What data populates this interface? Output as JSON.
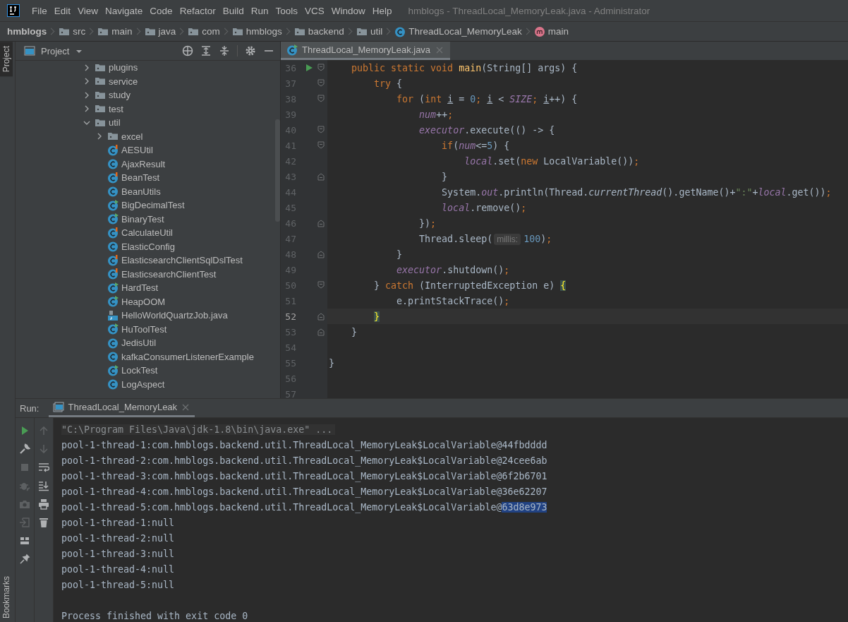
{
  "window": {
    "title": "hmblogs - ThreadLocal_MemoryLeak.java - Administrator"
  },
  "menu": [
    "File",
    "Edit",
    "View",
    "Navigate",
    "Code",
    "Refactor",
    "Build",
    "Run",
    "Tools",
    "VCS",
    "Window",
    "Help"
  ],
  "breadcrumbs": [
    {
      "kind": "project",
      "label": "hmblogs"
    },
    {
      "kind": "folder",
      "label": "src"
    },
    {
      "kind": "folder",
      "label": "main"
    },
    {
      "kind": "folder",
      "label": "java"
    },
    {
      "kind": "folder",
      "label": "com"
    },
    {
      "kind": "folder",
      "label": "hmblogs"
    },
    {
      "kind": "folder",
      "label": "backend"
    },
    {
      "kind": "folder",
      "label": "util"
    },
    {
      "kind": "class",
      "label": "ThreadLocal_MemoryLeak"
    },
    {
      "kind": "method",
      "label": "main"
    }
  ],
  "tool_windows": {
    "top": [
      {
        "label": "Project",
        "selected": true
      }
    ],
    "bottom": [
      {
        "label": "Bookmarks",
        "selected": false
      }
    ]
  },
  "project_panel": {
    "title": "Project",
    "tree": [
      {
        "kind": "folder",
        "label": "plugins",
        "expanded": false
      },
      {
        "kind": "folder",
        "label": "service",
        "expanded": false
      },
      {
        "kind": "folder",
        "label": "study",
        "expanded": false
      },
      {
        "kind": "folder",
        "label": "test",
        "expanded": false
      },
      {
        "kind": "folder",
        "label": "util",
        "expanded": true,
        "children": [
          {
            "kind": "folder",
            "label": "excel",
            "expanded": false
          },
          {
            "kind": "test_class",
            "label": "AESUtil"
          },
          {
            "kind": "class",
            "label": "AjaxResult"
          },
          {
            "kind": "test_class",
            "label": "BeanTest"
          },
          {
            "kind": "class",
            "label": "BeanUtils"
          },
          {
            "kind": "runnable_class",
            "label": "BigDecimalTest"
          },
          {
            "kind": "runnable_class",
            "label": "BinaryTest"
          },
          {
            "kind": "test_class",
            "label": "CalculateUtil"
          },
          {
            "kind": "class",
            "label": "ElasticConfig"
          },
          {
            "kind": "test_class",
            "label": "ElasticsearchClientSqlDslTest"
          },
          {
            "kind": "test_class",
            "label": "ElasticsearchClientTest"
          },
          {
            "kind": "runnable_class",
            "label": "HardTest"
          },
          {
            "kind": "runnable_class",
            "label": "HeapOOM"
          },
          {
            "kind": "java_file",
            "label": "HelloWorldQuartzJob.java"
          },
          {
            "kind": "runnable_class",
            "label": "HuToolTest"
          },
          {
            "kind": "class",
            "label": "JedisUtil"
          },
          {
            "kind": "class",
            "label": "kafkaConsumerListenerExample"
          },
          {
            "kind": "runnable_class",
            "label": "LockTest"
          },
          {
            "kind": "class",
            "label": "LogAspect"
          }
        ]
      }
    ]
  },
  "editor": {
    "tabs": [
      {
        "label": "ThreadLocal_MemoryLeak.java",
        "selected": true
      }
    ],
    "lines": [
      {
        "number": "36",
        "run": true,
        "fold_start": true,
        "current": false,
        "tokens": [
          {
            "kind": "keyword",
            "text": "    public static void "
          },
          {
            "kind": "method_decl",
            "text": "main"
          },
          {
            "kind": "plain",
            "text": "(String[] args) {"
          }
        ]
      },
      {
        "number": "37",
        "run": false,
        "fold_start": true,
        "current": false,
        "tokens": [
          {
            "kind": "keyword",
            "text": "        try "
          },
          {
            "kind": "plain",
            "text": "{"
          }
        ]
      },
      {
        "number": "38",
        "run": false,
        "fold_start": true,
        "current": false,
        "tokens": [
          {
            "kind": "keyword",
            "text": "            for "
          },
          {
            "kind": "plain",
            "text": "("
          },
          {
            "kind": "keyword",
            "text": "int "
          },
          {
            "kind": "var",
            "text": "i"
          },
          {
            "kind": "plain",
            "text": " = "
          },
          {
            "kind": "number",
            "text": "0"
          },
          {
            "kind": "keyword",
            "text": "; "
          },
          {
            "kind": "var",
            "text": "i"
          },
          {
            "kind": "plain",
            "text": " < "
          },
          {
            "kind": "field",
            "text": "SIZE"
          },
          {
            "kind": "keyword",
            "text": "; "
          },
          {
            "kind": "var",
            "text": "i"
          },
          {
            "kind": "plain",
            "text": "++) {"
          }
        ]
      },
      {
        "number": "39",
        "run": false,
        "current": false,
        "tokens": [
          {
            "kind": "field",
            "text": "                num"
          },
          {
            "kind": "plain",
            "text": "++"
          },
          {
            "kind": "keyword",
            "text": ";"
          }
        ]
      },
      {
        "number": "40",
        "run": false,
        "fold_start": true,
        "current": false,
        "tokens": [
          {
            "kind": "field",
            "text": "                executor"
          },
          {
            "kind": "plain",
            "text": ".execute(() -> {"
          }
        ]
      },
      {
        "number": "41",
        "run": false,
        "fold_start": true,
        "current": false,
        "tokens": [
          {
            "kind": "keyword",
            "text": "                    if"
          },
          {
            "kind": "plain",
            "text": "("
          },
          {
            "kind": "field",
            "text": "num"
          },
          {
            "kind": "plain",
            "text": "<="
          },
          {
            "kind": "number",
            "text": "5"
          },
          {
            "kind": "plain",
            "text": ") {"
          }
        ]
      },
      {
        "number": "42",
        "run": false,
        "current": false,
        "tokens": [
          {
            "kind": "field",
            "text": "                        local"
          },
          {
            "kind": "plain",
            "text": ".set("
          },
          {
            "kind": "keyword",
            "text": "new "
          },
          {
            "kind": "plain",
            "text": "LocalVariable())"
          },
          {
            "kind": "keyword",
            "text": ";"
          }
        ]
      },
      {
        "number": "43",
        "run": false,
        "fold_end": true,
        "current": false,
        "tokens": [
          {
            "kind": "plain",
            "text": "                    }"
          }
        ]
      },
      {
        "number": "44",
        "run": false,
        "current": false,
        "tokens": [
          {
            "kind": "plain",
            "text": "                    System."
          },
          {
            "kind": "field",
            "text": "out"
          },
          {
            "kind": "plain",
            "text": ".println(Thread."
          },
          {
            "kind": "static_method",
            "text": "currentThread"
          },
          {
            "kind": "plain",
            "text": "().getName()+"
          },
          {
            "kind": "string",
            "text": "\":\""
          },
          {
            "kind": "plain",
            "text": "+"
          },
          {
            "kind": "field",
            "text": "local"
          },
          {
            "kind": "plain",
            "text": ".get())"
          },
          {
            "kind": "keyword",
            "text": ";"
          }
        ]
      },
      {
        "number": "45",
        "run": false,
        "current": false,
        "tokens": [
          {
            "kind": "field",
            "text": "                    local"
          },
          {
            "kind": "plain",
            "text": ".remove()"
          },
          {
            "kind": "keyword",
            "text": ";"
          }
        ]
      },
      {
        "number": "46",
        "run": false,
        "fold_end": true,
        "current": false,
        "tokens": [
          {
            "kind": "plain",
            "text": "                })"
          },
          {
            "kind": "keyword",
            "text": ";"
          }
        ]
      },
      {
        "number": "47",
        "run": false,
        "current": false,
        "tokens": [
          {
            "kind": "plain",
            "text": "                Thread.sleep("
          },
          {
            "kind": "hint",
            "text": "millis:"
          },
          {
            "kind": "number",
            "text": "100"
          },
          {
            "kind": "plain",
            "text": ")"
          },
          {
            "kind": "keyword",
            "text": ";"
          }
        ]
      },
      {
        "number": "48",
        "run": false,
        "fold_end": true,
        "current": false,
        "tokens": [
          {
            "kind": "plain",
            "text": "            }"
          }
        ]
      },
      {
        "number": "49",
        "run": false,
        "current": false,
        "tokens": [
          {
            "kind": "field",
            "text": "            executor"
          },
          {
            "kind": "plain",
            "text": ".shutdown()"
          },
          {
            "kind": "keyword",
            "text": ";"
          }
        ]
      },
      {
        "number": "50",
        "run": false,
        "fold_start": true,
        "current": false,
        "tokens": [
          {
            "kind": "plain",
            "text": "        } "
          },
          {
            "kind": "keyword",
            "text": "catch "
          },
          {
            "kind": "plain",
            "text": "(InterruptedException e) "
          },
          {
            "kind": "brace",
            "text": "{"
          }
        ]
      },
      {
        "number": "51",
        "run": false,
        "current": false,
        "tokens": [
          {
            "kind": "plain",
            "text": "            e.printStackTrace()"
          },
          {
            "kind": "keyword",
            "text": ";"
          }
        ]
      },
      {
        "number": "52",
        "run": false,
        "fold_end": true,
        "current": true,
        "tokens": [
          {
            "kind": "brace",
            "text": "        }"
          }
        ]
      },
      {
        "number": "53",
        "run": false,
        "fold_end": true,
        "current": false,
        "tokens": [
          {
            "kind": "plain",
            "text": "    }"
          }
        ]
      },
      {
        "number": "54",
        "run": false,
        "current": false
      },
      {
        "number": "55",
        "run": false,
        "current": false,
        "tokens": [
          {
            "kind": "plain",
            "text": "}"
          }
        ]
      },
      {
        "number": "56",
        "run": false,
        "current": false
      },
      {
        "number": "57",
        "run": false,
        "current": false
      }
    ]
  },
  "run_panel": {
    "label": "Run:",
    "tabs": [
      {
        "label": "ThreadLocal_MemoryLeak",
        "selected": true
      }
    ],
    "toolbar_main": [
      {
        "kind": "rerun",
        "disabled": false
      },
      {
        "kind": "wrench",
        "disabled": false
      },
      {
        "kind": "stop",
        "disabled": true
      },
      {
        "kind": "debug",
        "disabled": true
      },
      {
        "kind": "camera",
        "disabled": true
      },
      {
        "kind": "exit",
        "disabled": true
      },
      {
        "kind": "layout",
        "disabled": false
      },
      {
        "kind": "pin",
        "disabled": false
      }
    ],
    "toolbar_secondary": [
      {
        "kind": "up",
        "disabled": true
      },
      {
        "kind": "down",
        "disabled": true
      },
      {
        "kind": "wrap",
        "disabled": false
      },
      {
        "kind": "scroll_end",
        "disabled": false
      },
      {
        "kind": "print",
        "disabled": false
      },
      {
        "kind": "trash",
        "disabled": false
      }
    ],
    "output": [
      {
        "kind": "command",
        "text": "\"C:\\Program Files\\Java\\jdk-1.8\\bin\\java.exe\" ..."
      },
      {
        "kind": "output",
        "text": "pool-1-thread-1:com.hmblogs.backend.util.ThreadLocal_MemoryLeak$LocalVariable@44fbdddd"
      },
      {
        "kind": "output",
        "text": "pool-1-thread-2:com.hmblogs.backend.util.ThreadLocal_MemoryLeak$LocalVariable@24cee6ab"
      },
      {
        "kind": "output",
        "text": "pool-1-thread-3:com.hmblogs.backend.util.ThreadLocal_MemoryLeak$LocalVariable@6f2b6701"
      },
      {
        "kind": "output",
        "text": "pool-1-thread-4:com.hmblogs.backend.util.ThreadLocal_MemoryLeak$LocalVariable@36e62207"
      },
      {
        "kind": "output",
        "text": "pool-1-thread-5:com.hmblogs.backend.util.ThreadLocal_MemoryLeak$LocalVariable@",
        "selection": "63d8e973"
      },
      {
        "kind": "output",
        "text": "pool-1-thread-1:null"
      },
      {
        "kind": "output",
        "text": "pool-1-thread-2:null"
      },
      {
        "kind": "output",
        "text": "pool-1-thread-3:null"
      },
      {
        "kind": "output",
        "text": "pool-1-thread-4:null"
      },
      {
        "kind": "output",
        "text": "pool-1-thread-5:null"
      },
      {
        "kind": "exit",
        "text": "Process finished with exit code 0"
      }
    ]
  }
}
